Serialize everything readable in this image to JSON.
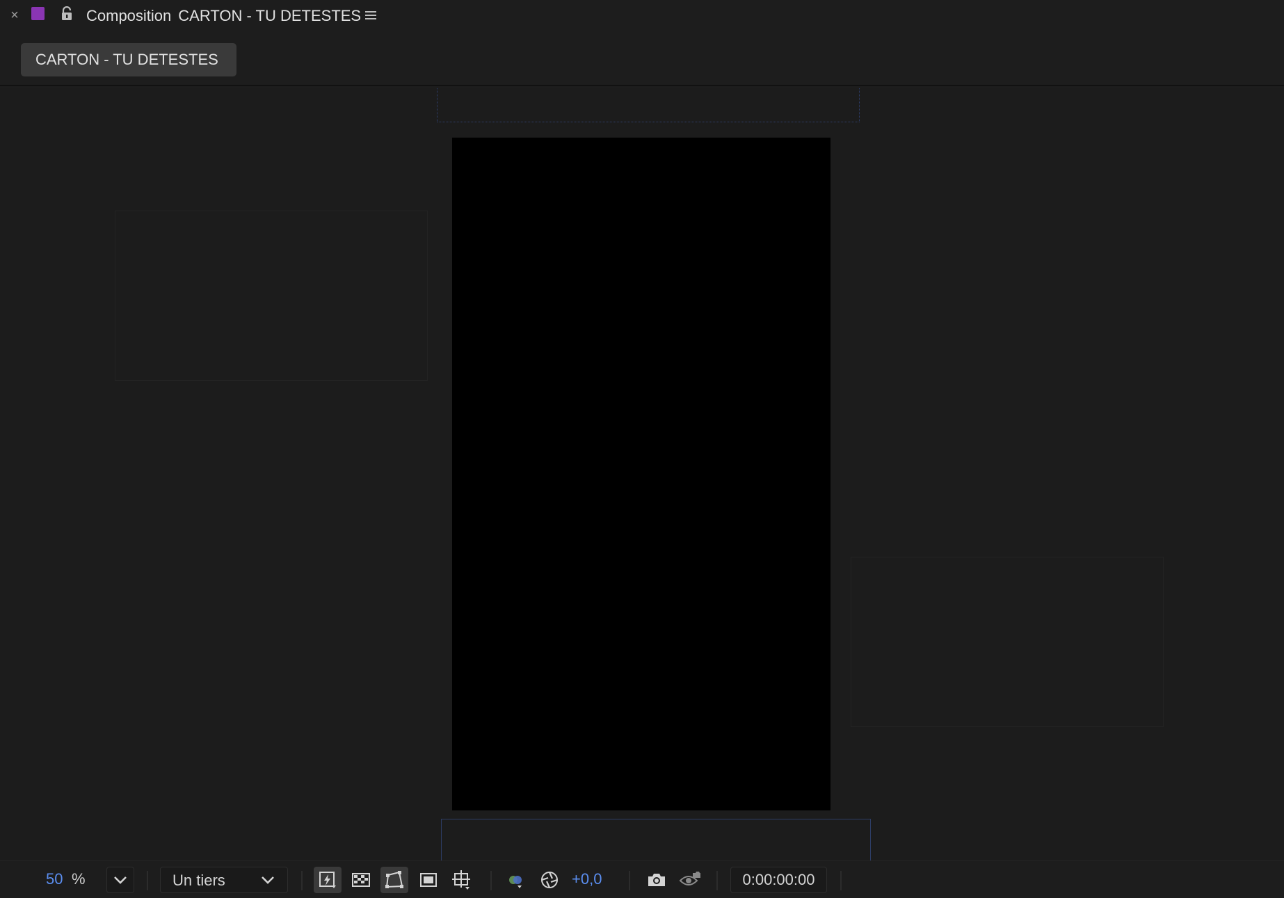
{
  "panel": {
    "close_glyph": "×",
    "title_prefix": "Composition",
    "title_name": "CARTON - TU DETESTES",
    "composition_color": "#8a35b3"
  },
  "tabs": [
    {
      "label": "CARTON - TU DETESTES",
      "active": true
    }
  ],
  "viewer": {
    "frame_color": "#000000"
  },
  "bottom_bar": {
    "zoom_value": "50",
    "zoom_unit": "%",
    "resolution": "Un tiers",
    "exposure": "+0,0",
    "timecode": "0:00:00:00",
    "accent_color": "#5b8ef0",
    "icons": [
      "fast-previews-icon",
      "transparency-grid-icon",
      "mask-path-visibility-icon",
      "region-of-interest-icon",
      "grid-guides-icon",
      "show-channel-icon",
      "reset-exposure-icon",
      "snapshot-icon",
      "show-snapshot-icon"
    ]
  }
}
